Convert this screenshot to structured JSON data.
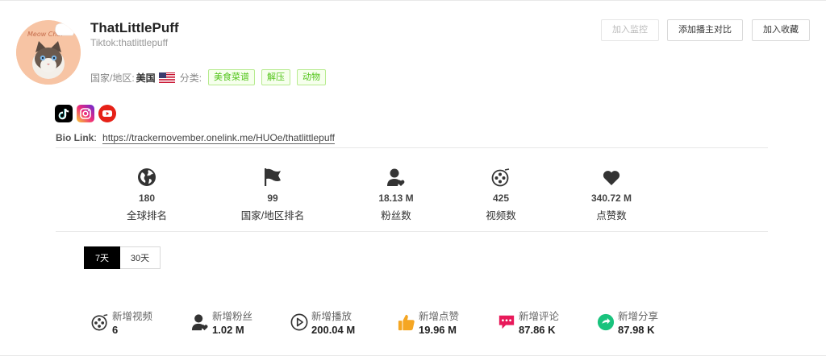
{
  "profile": {
    "name": "ThatLittlePuff",
    "handle": "Tiktok:thatlittlepuff",
    "region_label": "国家/地区:",
    "region_value": "美国",
    "category_label": "分类:",
    "tags": [
      "美食菜谱",
      "解压",
      "动物"
    ],
    "avatar_text": "Meow Chef",
    "bio_label": "Bio Link",
    "bio_sep": ":",
    "bio_url": "https://trackernovember.onelink.me/HUOe/thatlittlepuff"
  },
  "actions": {
    "monitor": "加入监控",
    "compare": "添加播主对比",
    "favorite": "加入收藏"
  },
  "stats": [
    {
      "value": "180",
      "label": "全球排名",
      "icon": "globe-icon"
    },
    {
      "value": "99",
      "label": "国家/地区排名",
      "icon": "flag-icon"
    },
    {
      "value": "18.13 M",
      "label": "粉丝数",
      "icon": "user-heart-icon"
    },
    {
      "value": "425",
      "label": "视频数",
      "icon": "film-reel-icon"
    },
    {
      "value": "340.72 M",
      "label": "点赞数",
      "icon": "heart-icon"
    }
  ],
  "tabs": [
    "7天",
    "30天"
  ],
  "increments": [
    {
      "label": "新增视频",
      "value": "6",
      "icon": "film-reel-icon",
      "color": "#333333"
    },
    {
      "label": "新增粉丝",
      "value": "1.02 M",
      "icon": "user-heart-icon",
      "color": "#333333"
    },
    {
      "label": "新增播放",
      "value": "200.04 M",
      "icon": "play-circle-icon",
      "color": "#333333"
    },
    {
      "label": "新增点赞",
      "value": "19.96 M",
      "icon": "thumbs-up-icon",
      "color": "#f5a623"
    },
    {
      "label": "新增评论",
      "value": "87.86 K",
      "icon": "comment-icon",
      "color": "#e8195a"
    },
    {
      "label": "新增分享",
      "value": "87.98 K",
      "icon": "share-icon",
      "color": "#19c37d"
    }
  ],
  "colors": {
    "tag_text": "#52c41a",
    "tag_bg": "#f6ffed",
    "tiktok": "#000000",
    "instagram": "#c13584",
    "youtube": "#e62117"
  }
}
